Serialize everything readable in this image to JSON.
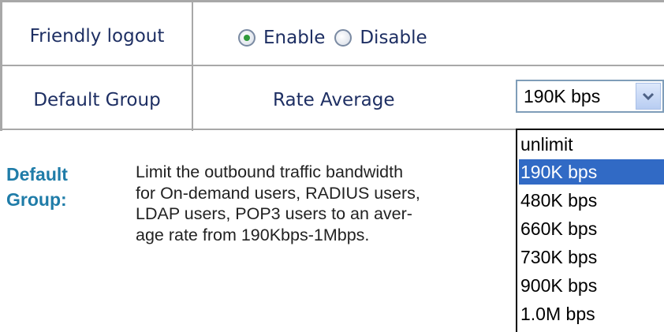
{
  "settings": {
    "friendly_logout": {
      "label": "Friendly logout",
      "options": [
        {
          "label": "Enable",
          "checked": true
        },
        {
          "label": "Disable",
          "checked": false
        }
      ]
    },
    "default_group": {
      "label": "Default Group",
      "rate_label": "Rate Average",
      "selected_value": "190K bps",
      "options": [
        "unlimit",
        "190K bps",
        "480K bps",
        "660K bps",
        "730K bps",
        "900K bps",
        "1.0M bps"
      ],
      "selected_index": 1
    }
  },
  "description": {
    "title_line1": "Default",
    "title_line2": "Group:",
    "lines": [
      "Limit the outbound traffic bandwidth",
      "for On-demand users, RADIUS users,",
      "LDAP users, POP3 users to an aver-",
      "age rate from 190Kbps-1Mbps."
    ]
  },
  "colors": {
    "label_text": "#1e2f63",
    "description_title": "#1f7ca8",
    "selection_highlight": "#316ac5",
    "radio_checked": "#2f9a3a"
  },
  "icons": {
    "select_arrow": "chevron-down-icon"
  }
}
